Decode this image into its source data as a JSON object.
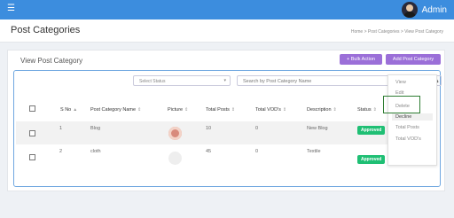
{
  "topbar": {
    "menu_icon": "hamburger-icon",
    "user_name": "Admin",
    "accent": "#3c8dde"
  },
  "page": {
    "title": "Post Categories",
    "breadcrumbs": "Home  >  Post Categories  >  View Post Category"
  },
  "card": {
    "title": "View Post Category",
    "bulk_button": "+ Bulk Action",
    "add_button": "Add Post Category"
  },
  "filters": {
    "status_placeholder": "Select Status",
    "search_placeholder": "Search by Post Category Name"
  },
  "table": {
    "columns": [
      "S No",
      "Post Category Name",
      "Picture",
      "Total Posts",
      "Total VOD's",
      "Description",
      "Status"
    ],
    "rows": [
      {
        "sno": "1",
        "name": "Blog",
        "total_posts": "10",
        "total_vods": "0",
        "description": "New Blog",
        "status": "Approved"
      },
      {
        "sno": "2",
        "name": "cloth",
        "total_posts": "45",
        "total_vods": "0",
        "description": "Textile",
        "status": "Approved"
      }
    ]
  },
  "action_menu": {
    "items": [
      "View",
      "Edit",
      "Delete",
      "Decline",
      "Total Posts",
      "Total VOD's"
    ]
  }
}
